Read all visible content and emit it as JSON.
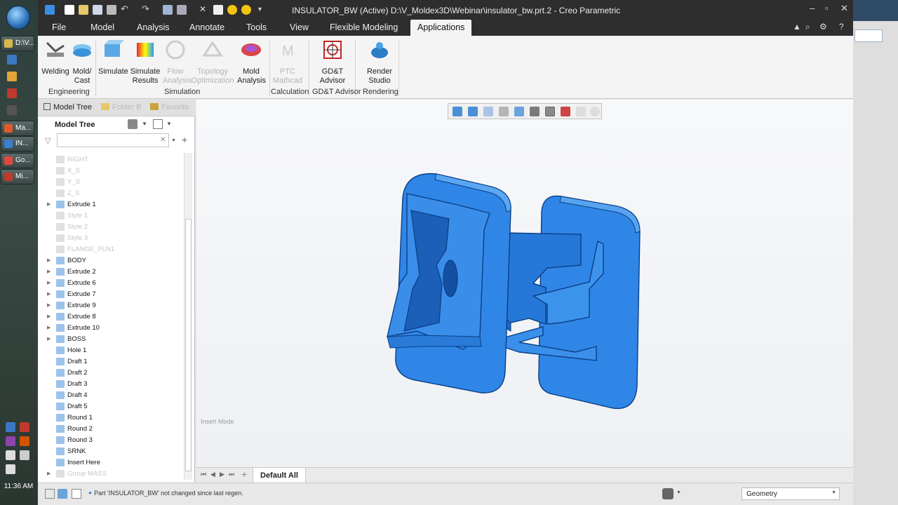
{
  "taskbar": {
    "buttons": [
      {
        "label": "D:\\V...",
        "color": "#d8b84a"
      },
      {
        "label": "Ma...",
        "color": "#e05a2a"
      },
      {
        "label": "IN...",
        "color": "#3a7fd0"
      },
      {
        "label": "Go...",
        "color": "#e04a3a"
      },
      {
        "label": "Mi...",
        "color": "#c0392b"
      }
    ],
    "clock": "11:36 AM"
  },
  "window": {
    "title": "INSULATOR_BW (Active) D:\\V_Moldex3D\\Webinar\\insulator_bw.prt.2 - Creo Parametric"
  },
  "menu": {
    "items": [
      "File",
      "Model",
      "Analysis",
      "Annotate",
      "Tools",
      "View",
      "Flexible Modeling",
      "Applications"
    ],
    "active": "Applications"
  },
  "ribbon": {
    "buttons": [
      {
        "label": "Welding",
        "icon": "welding-icon",
        "disabled": false
      },
      {
        "label": "Mold/\nCast",
        "icon": "mold-cast-icon",
        "disabled": false
      },
      {
        "label": "Simulate",
        "icon": "simulate-icon",
        "disabled": false
      },
      {
        "label": "Simulate\nResults",
        "icon": "simulate-results-icon",
        "disabled": false
      },
      {
        "label": "Flow\nAnalysis",
        "icon": "flow-analysis-icon",
        "disabled": true
      },
      {
        "label": "Topology\nOptimization",
        "icon": "topology-icon",
        "disabled": true
      },
      {
        "label": "Mold\nAnalysis",
        "icon": "mold-analysis-icon",
        "disabled": false
      },
      {
        "label": "PTC\nMathcad",
        "icon": "mathcad-icon",
        "disabled": true
      },
      {
        "label": "GD&T\nAdvisor",
        "icon": "gdt-advisor-icon",
        "disabled": false
      },
      {
        "label": "Render\nStudio",
        "icon": "render-studio-icon",
        "disabled": false
      }
    ],
    "groups": [
      "Engineering",
      "Simulation",
      "Calculation",
      "GD&T Advisor",
      "Rendering"
    ]
  },
  "panel": {
    "tabs": [
      "Model Tree",
      "Folder B",
      "Favorite"
    ],
    "tree_title": "Model Tree",
    "filter_placeholder": "",
    "items": [
      {
        "label": "RIGHT",
        "dim": true,
        "expand": false
      },
      {
        "label": "X_S",
        "dim": true,
        "expand": false
      },
      {
        "label": "Y_S",
        "dim": true,
        "expand": false
      },
      {
        "label": "Z_S",
        "dim": true,
        "expand": false
      },
      {
        "label": "Extrude 1",
        "dim": false,
        "expand": true
      },
      {
        "label": "Style 1",
        "dim": true,
        "expand": false
      },
      {
        "label": "Style 2",
        "dim": true,
        "expand": false
      },
      {
        "label": "Style 3",
        "dim": true,
        "expand": false
      },
      {
        "label": "FLANGE_PLN1",
        "dim": true,
        "expand": false
      },
      {
        "label": "BODY",
        "dim": false,
        "expand": true
      },
      {
        "label": "Extrude 2",
        "dim": false,
        "expand": true
      },
      {
        "label": "Extrude 6",
        "dim": false,
        "expand": true
      },
      {
        "label": "Extrude 7",
        "dim": false,
        "expand": true
      },
      {
        "label": "Extrude 9",
        "dim": false,
        "expand": true
      },
      {
        "label": "Extrude 8",
        "dim": false,
        "expand": true
      },
      {
        "label": "Extrude 10",
        "dim": false,
        "expand": true
      },
      {
        "label": "BOSS",
        "dim": false,
        "expand": true
      },
      {
        "label": "Hole 1",
        "dim": false,
        "expand": false
      },
      {
        "label": "Draft 1",
        "dim": false,
        "expand": false
      },
      {
        "label": "Draft 2",
        "dim": false,
        "expand": false
      },
      {
        "label": "Draft 3",
        "dim": false,
        "expand": false
      },
      {
        "label": "Draft 4",
        "dim": false,
        "expand": false
      },
      {
        "label": "Draft 5",
        "dim": false,
        "expand": false
      },
      {
        "label": "Round 1",
        "dim": false,
        "expand": false
      },
      {
        "label": "Round 2",
        "dim": false,
        "expand": false
      },
      {
        "label": "Round 3",
        "dim": false,
        "expand": false
      },
      {
        "label": "SRNK",
        "dim": false,
        "expand": false
      },
      {
        "label": "Insert Here",
        "dim": false,
        "expand": false
      },
      {
        "label": "Group MASS",
        "dim": true,
        "expand": true
      }
    ]
  },
  "graphics": {
    "insert_mode": "Insert Mode",
    "model_color": "#2a7ee0"
  },
  "bottom_tab": "Default All",
  "status": {
    "message": "Part 'INSULATOR_BW' not changed since last regen.",
    "filter": "Geometry"
  }
}
